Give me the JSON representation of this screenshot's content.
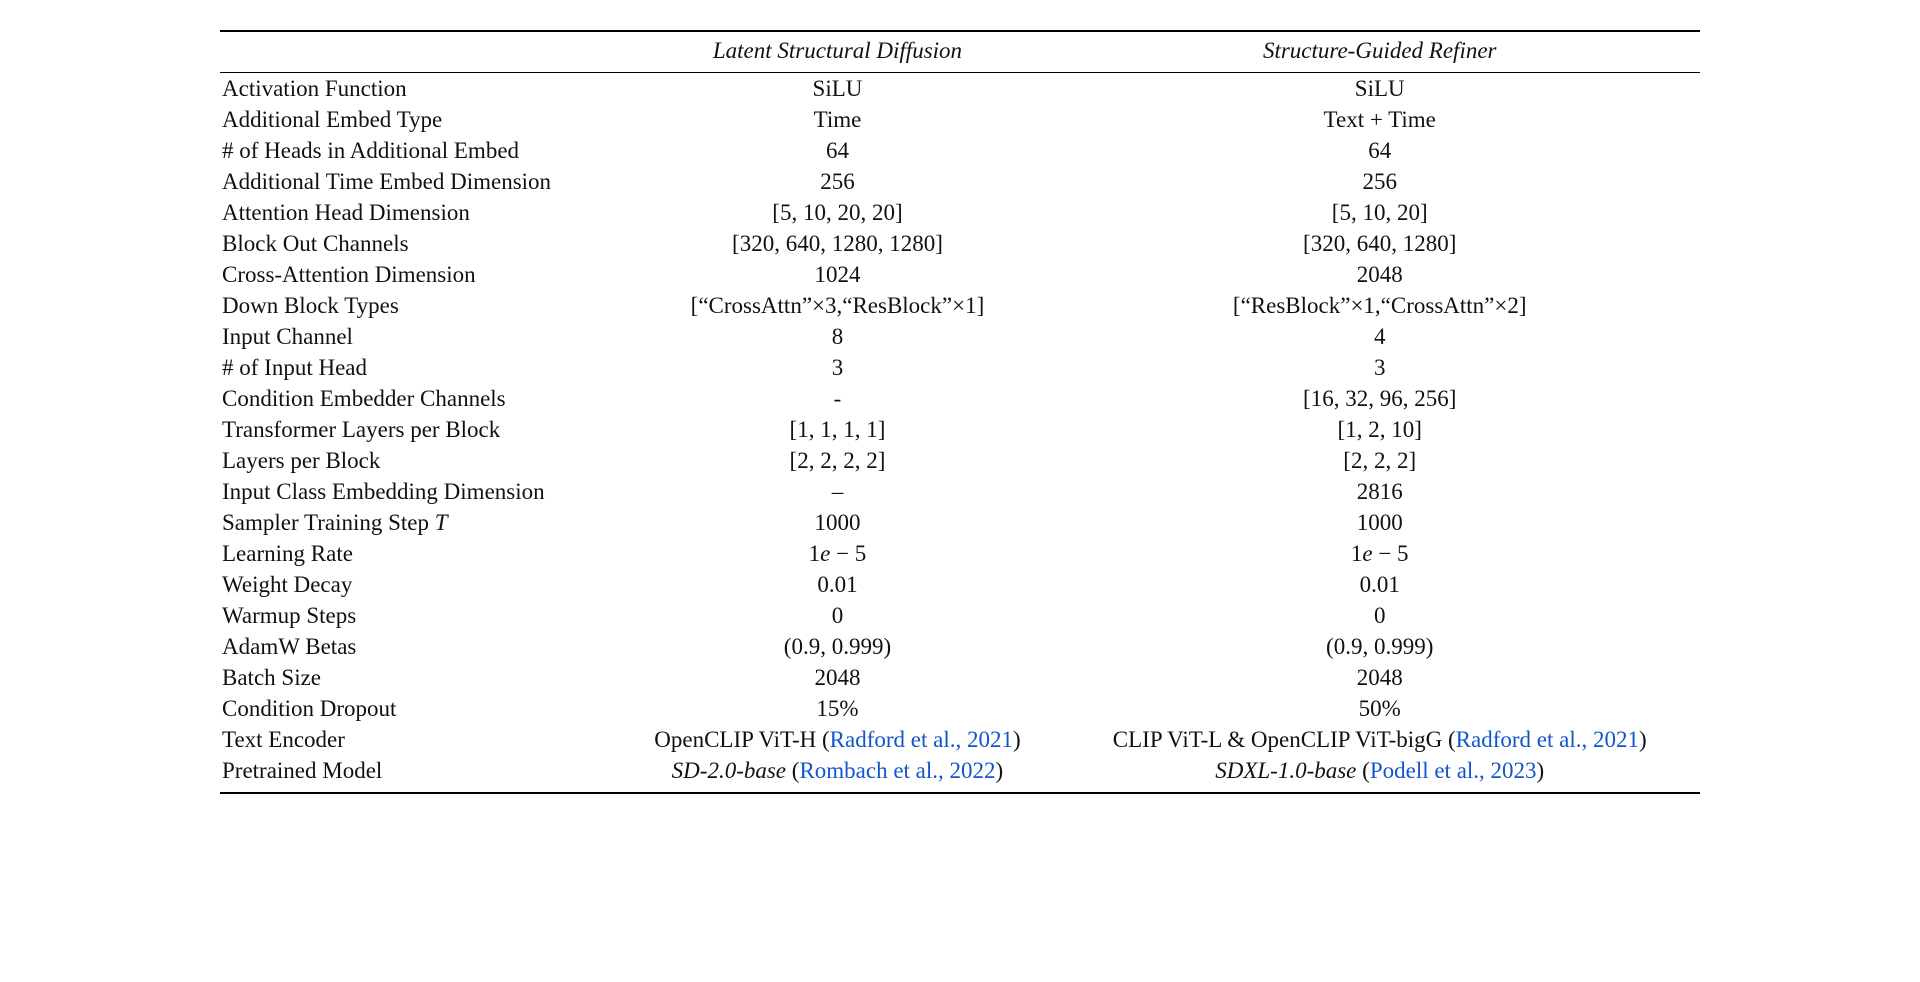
{
  "chart_data": {
    "type": "table",
    "title": "",
    "columns": [
      "Latent Structural Diffusion",
      "Structure-Guided Refiner"
    ],
    "rows": [
      {
        "param": "Activation Function",
        "col1": "SiLU",
        "col2": "SiLU"
      },
      {
        "param": "Additional Embed Type",
        "col1": "Time",
        "col2": "Text + Time"
      },
      {
        "param": "# of Heads in Additional Embed",
        "col1": "64",
        "col2": "64"
      },
      {
        "param": "Additional Time Embed Dimension",
        "col1": "256",
        "col2": "256"
      },
      {
        "param": "Attention Head Dimension",
        "col1": "[5, 10, 20, 20]",
        "col2": "[5, 10, 20]"
      },
      {
        "param": "Block Out Channels",
        "col1": "[320, 640, 1280, 1280]",
        "col2": "[320, 640, 1280]"
      },
      {
        "param": "Cross-Attention Dimension",
        "col1": "1024",
        "col2": "2048"
      },
      {
        "param": "Down Block Types",
        "col1": "[“CrossAttn”×3,“ResBlock”×1]",
        "col2": "[“ResBlock”×1,“CrossAttn”×2]"
      },
      {
        "param": "Input Channel",
        "col1": "8",
        "col2": "4"
      },
      {
        "param": "# of Input Head",
        "col1": "3",
        "col2": "3"
      },
      {
        "param": "Condition Embedder Channels",
        "col1": "-",
        "col2": "[16, 32, 96, 256]"
      },
      {
        "param": "Transformer Layers per Block",
        "col1": "[1, 1, 1, 1]",
        "col2": "[1, 2, 10]"
      },
      {
        "param": "Layers per Block",
        "col1": "[2, 2, 2, 2]",
        "col2": "[2, 2, 2]"
      },
      {
        "param": "Input Class Embedding Dimension",
        "col1": "–",
        "col2": "2816"
      },
      {
        "param": "Sampler Training Step ",
        "col1": "1000",
        "col2": "1000",
        "param_math_suffix": "T"
      },
      {
        "param": "Learning Rate",
        "col1": "1e − 5",
        "col2": "1e − 5",
        "math": true
      },
      {
        "param": "Weight Decay",
        "col1": "0.01",
        "col2": "0.01"
      },
      {
        "param": "Warmup Steps",
        "col1": "0",
        "col2": "0"
      },
      {
        "param": "AdamW Betas",
        "col1": "(0.9, 0.999)",
        "col2": "(0.9, 0.999)"
      },
      {
        "param": "Batch Size",
        "col1": "2048",
        "col2": "2048"
      },
      {
        "param": "Condition Dropout",
        "col1": "15%",
        "col2": "50%"
      },
      {
        "param": "Text Encoder",
        "col1_rich": {
          "plain": "OpenCLIP ViT-H (",
          "cite": "Radford et al., 2021",
          "after": ")"
        },
        "col2_rich": {
          "plain": "CLIP ViT-L & OpenCLIP ViT-bigG (",
          "cite": "Radford et al., 2021",
          "after": ")"
        }
      },
      {
        "param": "Pretrained Model",
        "col1_rich": {
          "em": "SD-2.0-base",
          "plain": " (",
          "cite": "Rombach et al., 2022",
          "after": ")"
        },
        "col2_rich": {
          "em": "SDXL-1.0-base",
          "plain": " (",
          "cite": "Podell et al., 2023",
          "after": ")"
        }
      }
    ]
  }
}
